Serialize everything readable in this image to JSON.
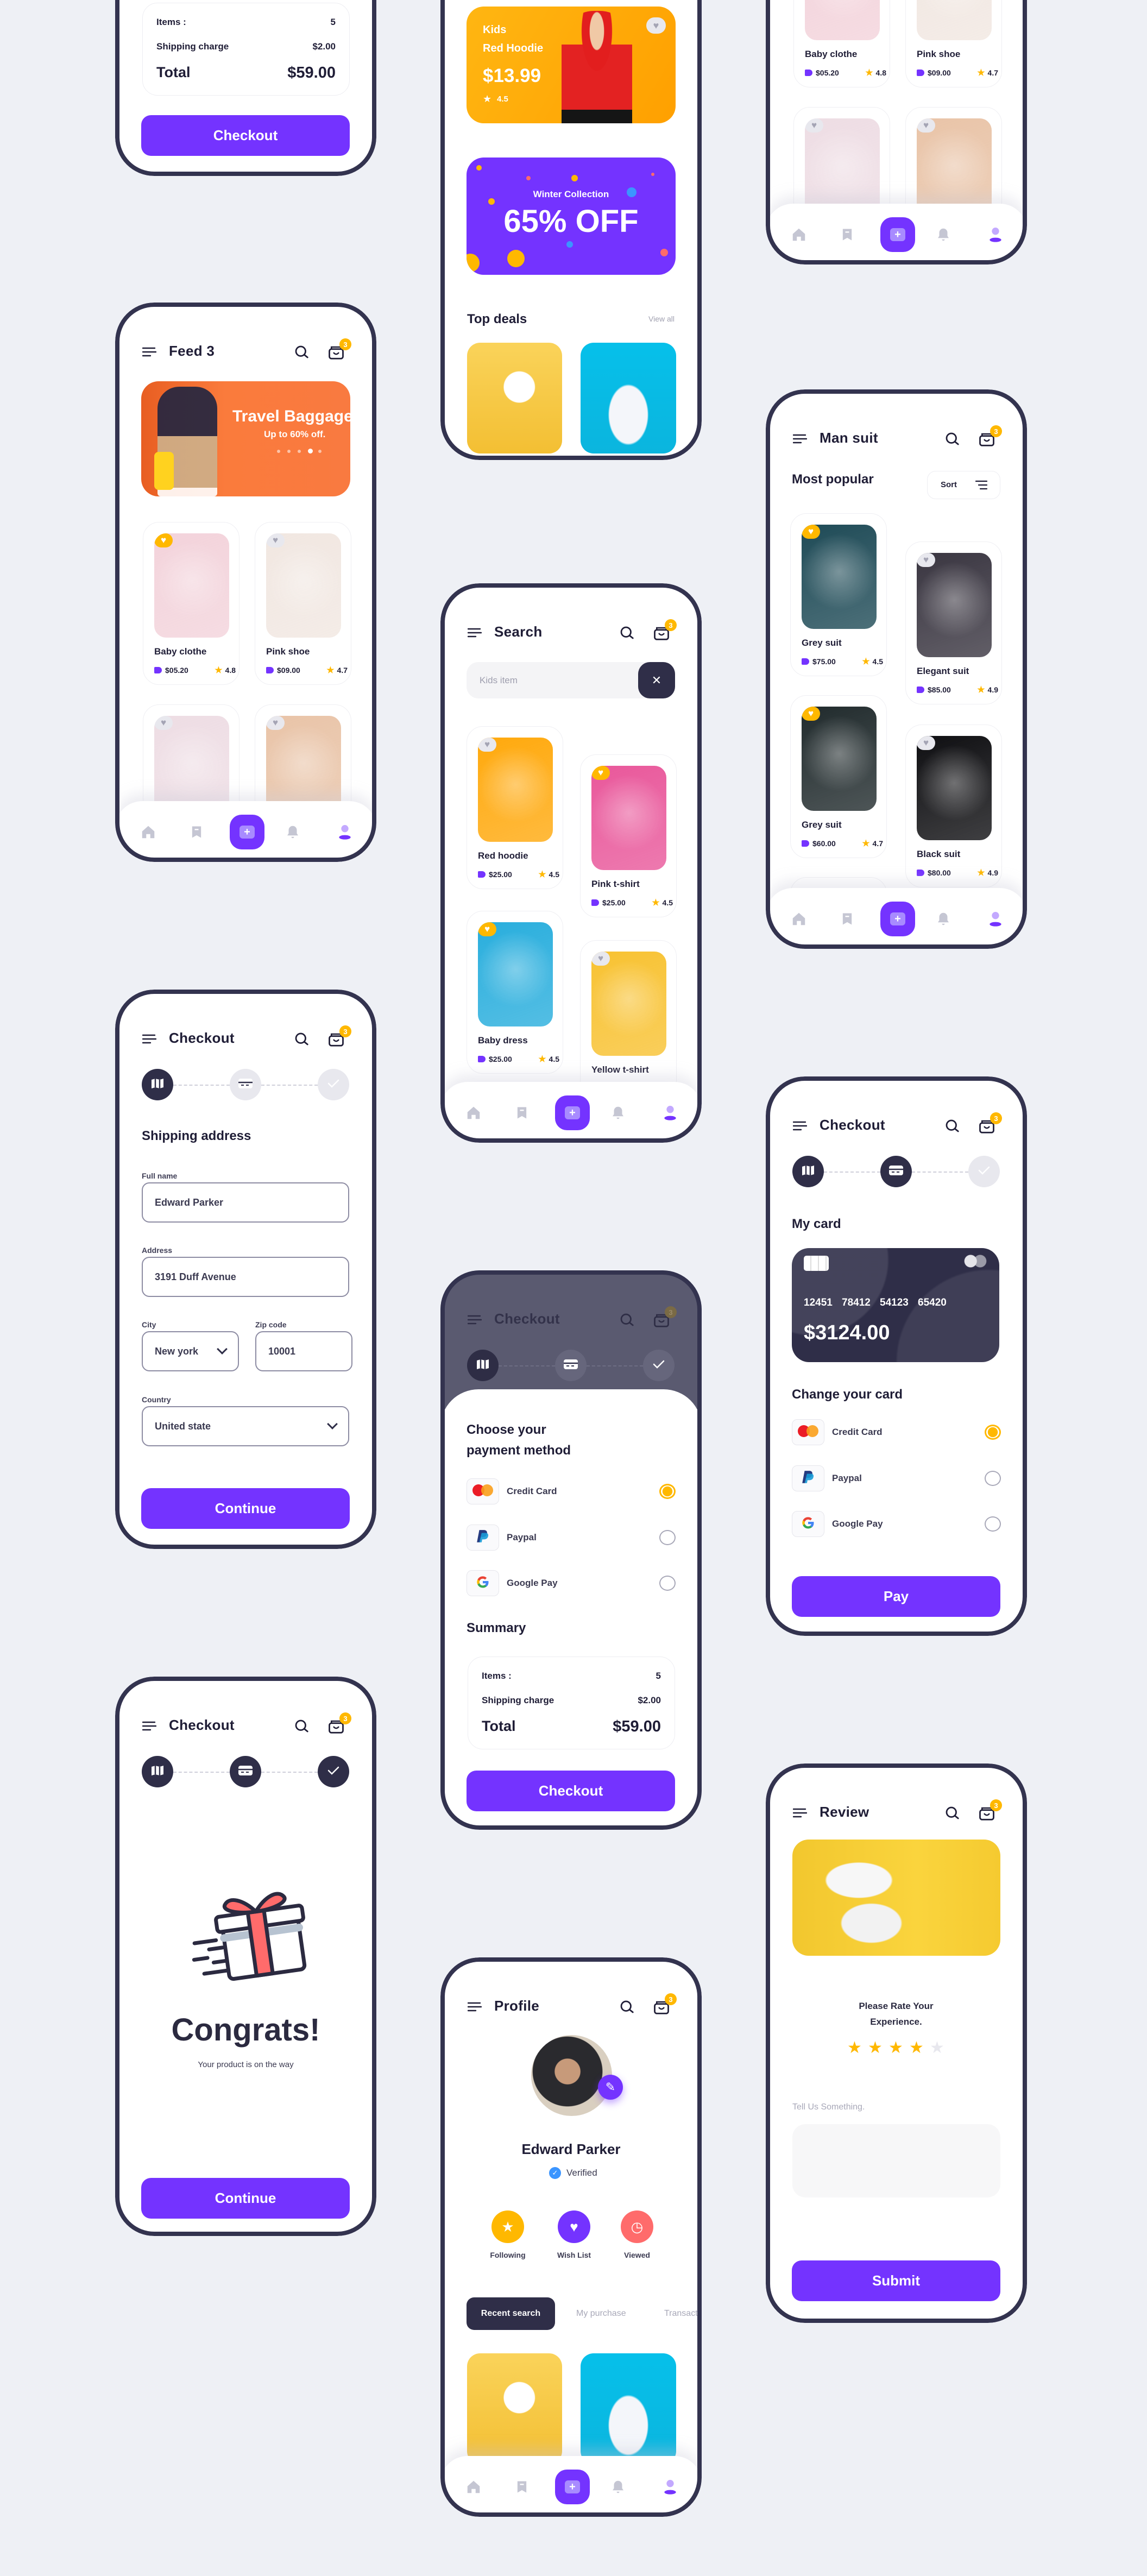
{
  "app": {
    "cart_badge": "3",
    "colors": {
      "primary": "#7433FF",
      "dark": "#2F2E48",
      "accent": "#FFB800",
      "background": "#EEF0F5"
    }
  },
  "icons": {
    "menu": "menu-icon",
    "search": "search-icon",
    "cart": "cart-icon",
    "nav": [
      "home-icon",
      "bookmark-icon",
      "add-icon",
      "bell-icon",
      "user-icon"
    ]
  },
  "order_summary": {
    "items_label": "Items :",
    "items_value": "5",
    "shipping_label": "Shipping charge",
    "shipping_value": "$2.00",
    "total_label": "Total",
    "total_value": "$59.00",
    "checkout_label": "Checkout"
  },
  "home": {
    "kids_banner": {
      "line1": "Kids",
      "line2": "Red Hoodie",
      "price": "$13.99",
      "rating": "4.5",
      "favorite": false
    },
    "winter_banner": {
      "subtitle": "Winter Collection",
      "title": "65% OFF"
    },
    "top_deals": {
      "title": "Top deals",
      "view_all": "View all"
    }
  },
  "feed": {
    "title": "Feed 3",
    "banner": {
      "title": "Travel Baggage",
      "subtitle": "Up to 60% off.",
      "slides": 5,
      "active_slide": 4
    },
    "products": [
      {
        "name": "Baby clothe",
        "price": "$05.20",
        "rating": "4.8",
        "favorite": true,
        "image_color": "#F3D3DB"
      },
      {
        "name": "Pink shoe",
        "price": "$09.00",
        "rating": "4.7",
        "favorite": false,
        "image_color": "#F1E7E1"
      },
      {
        "favorite": false,
        "image_color": "#EEDDE4"
      },
      {
        "favorite": false,
        "image_color": "#E9C4A8"
      }
    ]
  },
  "search": {
    "title": "Search",
    "query": "Kids item",
    "products": [
      {
        "name": "Red hoodie",
        "price": "$25.00",
        "rating": "4.5",
        "favorite": false,
        "image_color": "#FFA90D"
      },
      {
        "name": "Pink t-shirt",
        "price": "$25.00",
        "rating": "4.5",
        "favorite": true,
        "image_color": "#E9589B"
      },
      {
        "name": "Baby dress",
        "price": "$25.00",
        "rating": "4.5",
        "favorite": true,
        "image_color": "#29AEDD"
      },
      {
        "name": "Yellow t-shirt",
        "price": "$25.00",
        "rating": "4.5",
        "favorite": false,
        "image_color": "#F8C232"
      }
    ]
  },
  "man_suit": {
    "title": "Man suit",
    "section": "Most popular",
    "sort_label": "Sort",
    "products": [
      {
        "name": "Grey suit",
        "price": "$75.00",
        "rating": "4.5",
        "favorite": true,
        "image_color": "#1F4B57"
      },
      {
        "name": "Elegant suit",
        "price": "$85.00",
        "rating": "4.9",
        "favorite": false,
        "image_color": "#3A3641"
      },
      {
        "name": "Grey suit",
        "price": "$60.00",
        "rating": "4.7",
        "favorite": true,
        "image_color": "#212B2D"
      },
      {
        "name": "Black suit",
        "price": "$80.00",
        "rating": "4.9",
        "favorite": false,
        "image_color": "#0F0F12"
      },
      {
        "favorite": false,
        "image_color": "#1C1C24"
      }
    ]
  },
  "shipping": {
    "title": "Checkout",
    "heading": "Shipping address",
    "step": 1,
    "full_name_label": "Full name",
    "full_name": "Edward Parker",
    "address_label": "Address",
    "address": "3191  Duff Avenue",
    "city_label": "City",
    "city": "New york",
    "zip_label": "Zip code",
    "zip": "10001",
    "country_label": "Country",
    "country": "United state",
    "continue_label": "Continue"
  },
  "payment": {
    "title": "Checkout",
    "step": 1,
    "heading_line1": "Choose your",
    "heading_line2": "payment method",
    "methods": [
      {
        "label": "Credit Card",
        "icon": "mastercard-icon",
        "selected": true
      },
      {
        "label": "Paypal",
        "icon": "paypal-icon",
        "selected": false
      },
      {
        "label": "Google Pay",
        "icon": "google-icon",
        "selected": false
      }
    ],
    "summary_title": "Summary"
  },
  "card_screen": {
    "title": "Checkout",
    "step": 2,
    "my_card_label": "My card",
    "card": {
      "number": [
        "12451",
        "78412",
        "54123",
        "65420"
      ],
      "balance": "$3124.00"
    },
    "change_label": "Change your card",
    "methods": [
      {
        "label": "Credit Card",
        "icon": "mastercard-icon",
        "selected": true
      },
      {
        "label": "Paypal",
        "icon": "paypal-icon",
        "selected": false
      },
      {
        "label": "Google Pay",
        "icon": "google-icon",
        "selected": false
      }
    ],
    "pay_label": "Pay"
  },
  "congrats": {
    "title": "Checkout",
    "step": 3,
    "heading": "Congrats!",
    "subtitle": "Your product is on the way",
    "continue_label": "Continue"
  },
  "profile": {
    "title": "Profile",
    "name": "Edward Parker",
    "verified_label": "Verified",
    "actions": [
      {
        "label": "Following",
        "icon": "star-icon",
        "color": "#FFB800"
      },
      {
        "label": "Wish List",
        "icon": "heart-icon",
        "color": "#7433FF"
      },
      {
        "label": "Viewed",
        "icon": "clock-icon",
        "color": "#FF6B6B"
      }
    ],
    "tabs": [
      "Recent search",
      "My purchase",
      "Transaction"
    ],
    "active_tab": 0
  },
  "review": {
    "title": "Review",
    "prompt": "Please Rate Your Experience.",
    "rating": 4,
    "max_rating": 5,
    "comment_label": "Tell Us Something.",
    "comment": "",
    "submit_label": "Submit"
  }
}
